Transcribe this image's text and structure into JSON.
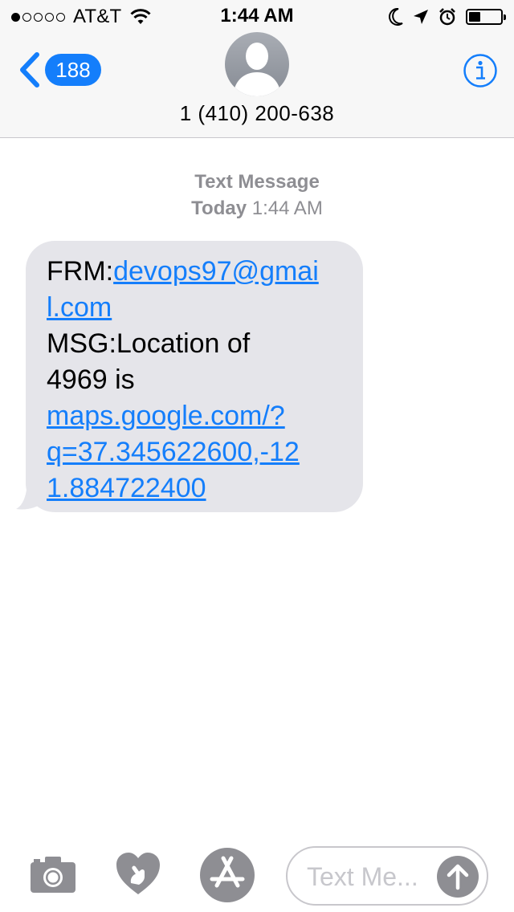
{
  "status_bar": {
    "signal_bars_filled": 1,
    "signal_bars_total": 5,
    "carrier": "AT&T",
    "time": "1:44 AM",
    "icons": [
      "wifi-icon",
      "moon-icon",
      "location-arrow-icon",
      "alarm-clock-icon",
      "battery-icon"
    ],
    "battery_level": 0.3
  },
  "nav": {
    "back_count": "188",
    "contact": "1 (410) 200-638",
    "icons": [
      "back-chevron-icon",
      "avatar-person-icon",
      "info-icon"
    ]
  },
  "conversation": {
    "service": "Text Message",
    "day": "Today",
    "time": "1:44 AM"
  },
  "message": {
    "line1_prefix": "FRM:",
    "line1_link": "devops97@gmai",
    "line2_link": "l.com",
    "line3": "MSG:Location of",
    "line4": "4969 is",
    "line5_link": "maps.google.com/?",
    "line6_link": "q=37.345622600,-12",
    "line7_link": "1.884722400"
  },
  "input_bar": {
    "placeholder": "Text Me...",
    "icons": [
      "camera-icon",
      "digital-touch-heart-icon",
      "app-store-icon",
      "send-arrow-icon"
    ]
  },
  "colors": {
    "accent": "#147efb",
    "bubble": "#e5e5ea",
    "meta_text": "#8e8e93",
    "bar_bg": "#f7f7f7"
  }
}
